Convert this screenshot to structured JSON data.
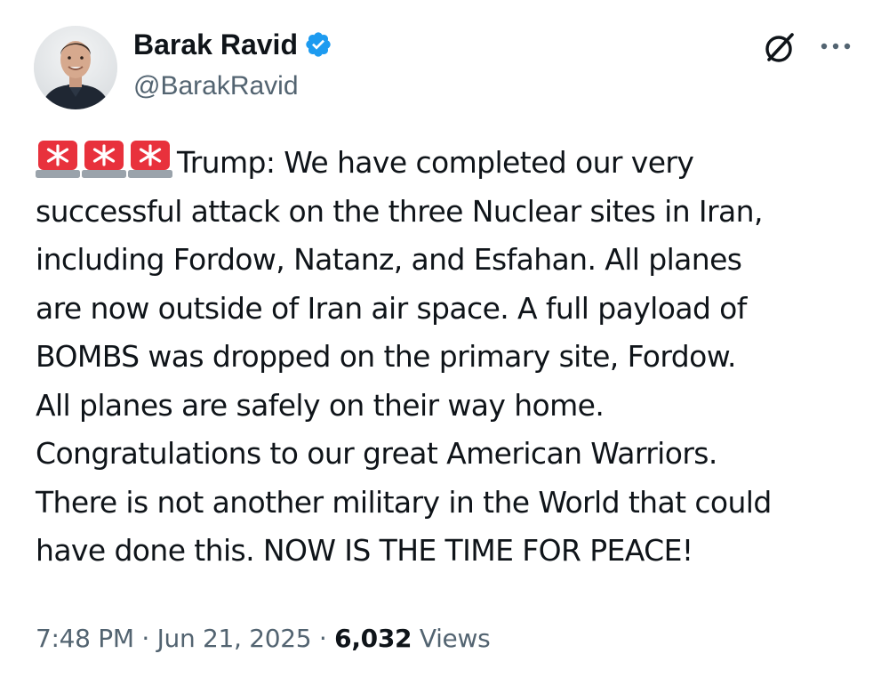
{
  "author": {
    "display_name": "Barak Ravid",
    "handle": "@BarakRavid",
    "verified": true,
    "avatar_icon": "profile-photo",
    "badge_color": "#1d9bf0"
  },
  "header_icons": {
    "grok": "grok-icon",
    "more": "more-options-icon"
  },
  "tweet": {
    "emoji": [
      "🚨",
      "🚨",
      "🚨"
    ],
    "lines": [
      "Trump: We have completed our very",
      "successful attack on the three Nuclear sites in Iran,",
      "including Fordow, Natanz, and Esfahan. All planes",
      "are now outside of Iran air space. A full payload of",
      "BOMBS was dropped on the primary site, Fordow.",
      "All planes are safely on their way home.",
      "Congratulations to our great American Warriors.",
      "There is not another military in the World that could",
      "have done this. NOW IS THE TIME FOR PEACE!"
    ]
  },
  "meta": {
    "time": "7:48 PM",
    "separator": "·",
    "date": "Jun 21, 2025",
    "views_count": "6,032",
    "views_label": "Views"
  },
  "colors": {
    "text_primary": "#0f1419",
    "text_secondary": "#536471",
    "verified_blue": "#1d9bf0",
    "siren_red": "#e8313c"
  }
}
